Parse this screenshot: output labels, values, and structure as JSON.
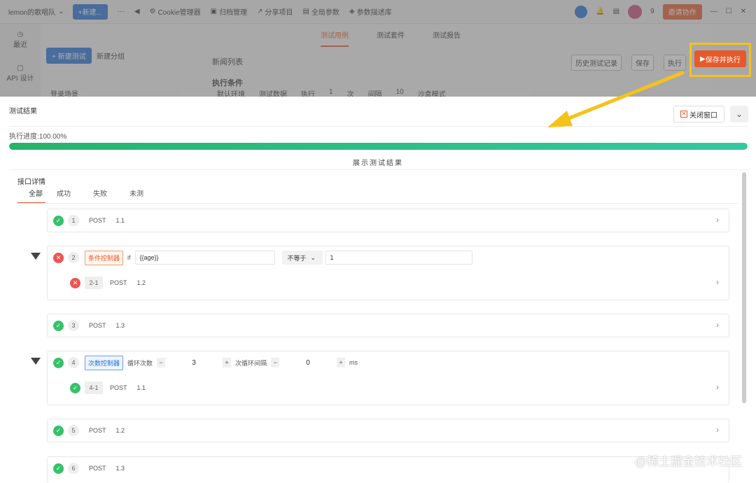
{
  "topbar": {
    "team_name": "lemon的歌唱队",
    "new_label": "+新建...",
    "items": [
      "Cookie管理器",
      "归档管理",
      "分享项目",
      "全局参数",
      "参数描述库"
    ],
    "notif_count": "9",
    "invite_label": "邀请协作"
  },
  "sidebar": {
    "items": [
      "最近",
      "API 设计"
    ]
  },
  "main_tabs": [
    "测试用例",
    "测试套件",
    "测试报告"
  ],
  "bg": {
    "new_test": "+ 新建测试",
    "new_group": "新建分组",
    "list_title": "新闻列表",
    "cond_title": "执行条件",
    "login_item": "登录场景",
    "env": "默认环境",
    "test_data": "测试数据",
    "exec": "执行",
    "count": "1",
    "times": "次",
    "interval": "间隔",
    "interval_val": "10",
    "sandbox": "沙盒模式",
    "history_btn": "历史测试记录",
    "save_btn": "保存",
    "run_btn": "执行",
    "save_run_btn": "保存并执行"
  },
  "panel": {
    "title": "测试结果",
    "close_label": "关闭窗口",
    "progress_label": "执行进度:100.00%",
    "progress_value": 1.0,
    "show_result": "展示测试结果",
    "detail_title": "接口详情",
    "filters": [
      "全部",
      "成功",
      "失败",
      "未测"
    ]
  },
  "cases": [
    {
      "status": "ok",
      "num": "1",
      "method": "POST",
      "path": "1.1"
    },
    {
      "status": "fail",
      "num": "2",
      "controller": "条件控制器",
      "if_label": "if",
      "cond": "{{age}}",
      "op": "不等于",
      "value": "1",
      "child": {
        "status": "fail",
        "num": "2-1",
        "method": "POST",
        "path": "1.2"
      }
    },
    {
      "status": "ok",
      "num": "3",
      "method": "POST",
      "path": "1.3"
    },
    {
      "status": "ok",
      "num": "4",
      "controller": "次数控制器",
      "loop_label": "循环次数",
      "loop_val": "3",
      "interval_label": "次循环间隔",
      "interval_val": "0",
      "unit": "ms",
      "child": {
        "status": "ok",
        "num": "4-1",
        "method": "POST",
        "path": "1.1"
      }
    },
    {
      "status": "ok",
      "num": "5",
      "method": "POST",
      "path": "1.2"
    },
    {
      "status": "ok",
      "num": "6",
      "method": "POST",
      "path": "1.3"
    }
  ],
  "watermark": "@稀土掘金技术社区",
  "colors": {
    "accent": "#e65a2a",
    "primary": "#1e6fd9",
    "success": "#35c26b",
    "fail": "#ef5350",
    "highlight": "#f6c21a"
  }
}
